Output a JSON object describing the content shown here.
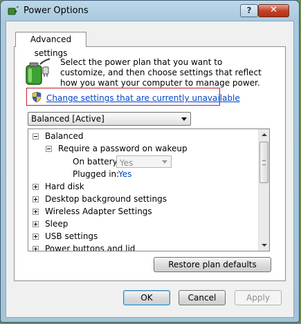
{
  "window": {
    "title": "Power Options",
    "help_label": "?",
    "close_label": "✕"
  },
  "tab": {
    "label": "Advanced settings"
  },
  "intro": {
    "text": "Select the power plan that you want to customize, and then choose settings that reflect how you want your computer to manage power.",
    "change_link": "Change settings that are currently unavailable"
  },
  "plan": {
    "selected": "Balanced [Active]"
  },
  "tree": {
    "root": "Balanced",
    "password": {
      "label": "Require a password on wakeup",
      "on_battery_label": "On battery:",
      "on_battery_value": "Yes",
      "plugged_in_label": "Plugged in:",
      "plugged_in_value": "Yes"
    },
    "items": [
      "Hard disk",
      "Desktop background settings",
      "Wireless Adapter Settings",
      "Sleep",
      "USB settings",
      "Power buttons and lid"
    ]
  },
  "buttons": {
    "restore": "Restore plan defaults",
    "ok": "OK",
    "cancel": "Cancel",
    "apply": "Apply"
  },
  "icons": {
    "app": "power-options-icon",
    "battery": "battery-plug-icon",
    "shield": "uac-shield-icon"
  }
}
